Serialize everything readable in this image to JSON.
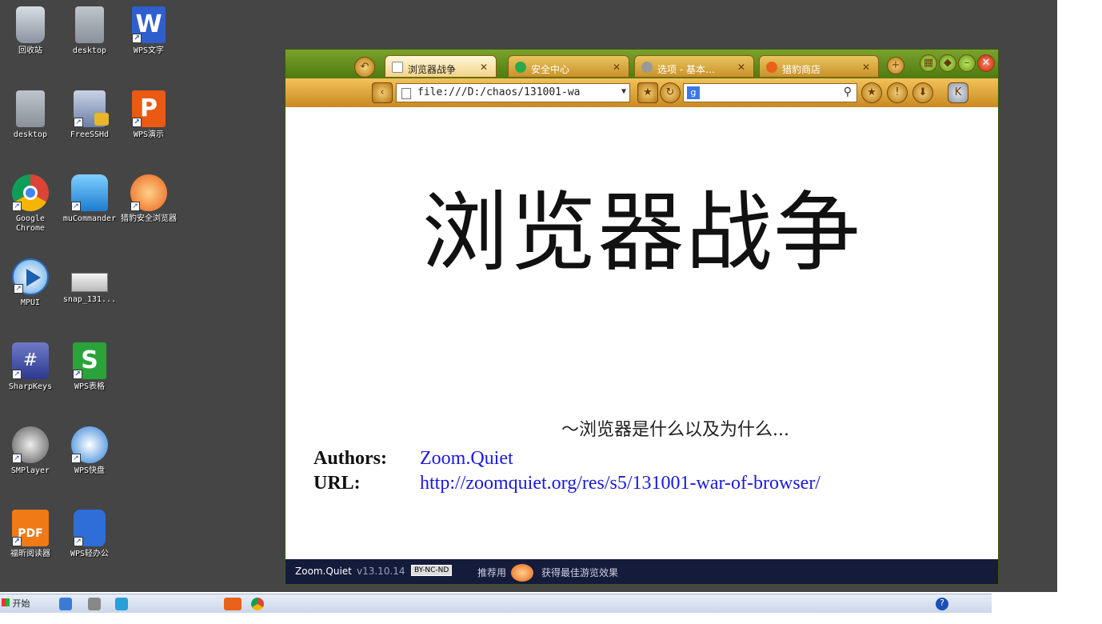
{
  "desktop": {
    "icons": [
      {
        "label": "回收站"
      },
      {
        "label": "desktop"
      },
      {
        "label": "WPS文字"
      },
      {
        "label": "desktop"
      },
      {
        "label": "FreeSSHd"
      },
      {
        "label": "WPS演示"
      },
      {
        "label": "Google Chrome"
      },
      {
        "label": "muCommander"
      },
      {
        "label": "猎豹安全浏览器"
      },
      {
        "label": "MPUI"
      },
      {
        "label": "snap_131..."
      },
      {
        "label": "SharpKeys"
      },
      {
        "label": "WPS表格"
      },
      {
        "label": "SMPlayer"
      },
      {
        "label": "WPS快盘"
      },
      {
        "label": "福昕阅读器"
      },
      {
        "label": "WPS轻办公"
      }
    ]
  },
  "taskbar": {
    "start_label": "开始"
  },
  "browser": {
    "tabs": [
      {
        "label": "浏览器战争"
      },
      {
        "label": "安全中心"
      },
      {
        "label": "选项 - 基本…"
      },
      {
        "label": "猎豹商店"
      }
    ],
    "url": "file:///D:/chaos/131001-wa",
    "search_placeholder": ""
  },
  "slide": {
    "title": "浏览器战争",
    "subtitle": "～浏览器是什么以及为什么...",
    "authors_key": "Authors:",
    "authors_val": "Zoom.Quiet",
    "url_key": "URL:",
    "url_val": "http://zoomquiet.org/res/s5/131001-war-of-browser/"
  },
  "footer": {
    "author": "Zoom.Quiet",
    "version": "v13.10.14",
    "license": "BY-NC-ND",
    "recommend": "推荐用",
    "best_effect": "获得最佳游览效果"
  },
  "colors": {
    "desktop_bg": "#454545",
    "link": "#1a1adc",
    "footer_bg": "#151b3a"
  }
}
